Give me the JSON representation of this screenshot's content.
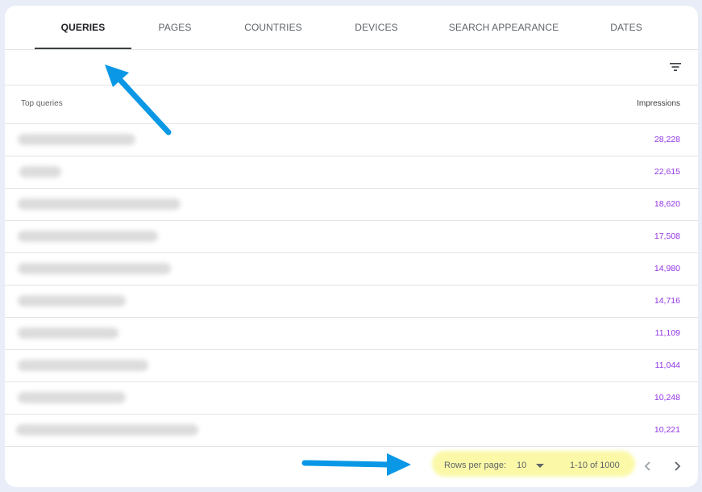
{
  "tabs": [
    {
      "label": "QUERIES",
      "active": true
    },
    {
      "label": "PAGES",
      "active": false
    },
    {
      "label": "COUNTRIES",
      "active": false
    },
    {
      "label": "DEVICES",
      "active": false
    },
    {
      "label": "SEARCH APPEARANCE",
      "active": false
    },
    {
      "label": "DATES",
      "active": false
    }
  ],
  "toolbar": {
    "filter_icon": "filter-list-icon"
  },
  "table": {
    "columns": {
      "query": "Top queries",
      "impressions": "Impressions"
    },
    "rows": [
      {
        "impressions": "28,228"
      },
      {
        "impressions": "22,615"
      },
      {
        "impressions": "18,620"
      },
      {
        "impressions": "17,508"
      },
      {
        "impressions": "14,980"
      },
      {
        "impressions": "14,716"
      },
      {
        "impressions": "11,109"
      },
      {
        "impressions": "11,044"
      },
      {
        "impressions": "10,248"
      },
      {
        "impressions": "10,221"
      }
    ]
  },
  "pagination": {
    "rows_per_page_label": "Rows per page:",
    "rows_per_page_value": "10",
    "range": "1-10 of 1000"
  },
  "colors": {
    "impressions": "#9334e6",
    "annotation_arrow": "#0a98e6",
    "highlight": "#fbf9a8"
  }
}
